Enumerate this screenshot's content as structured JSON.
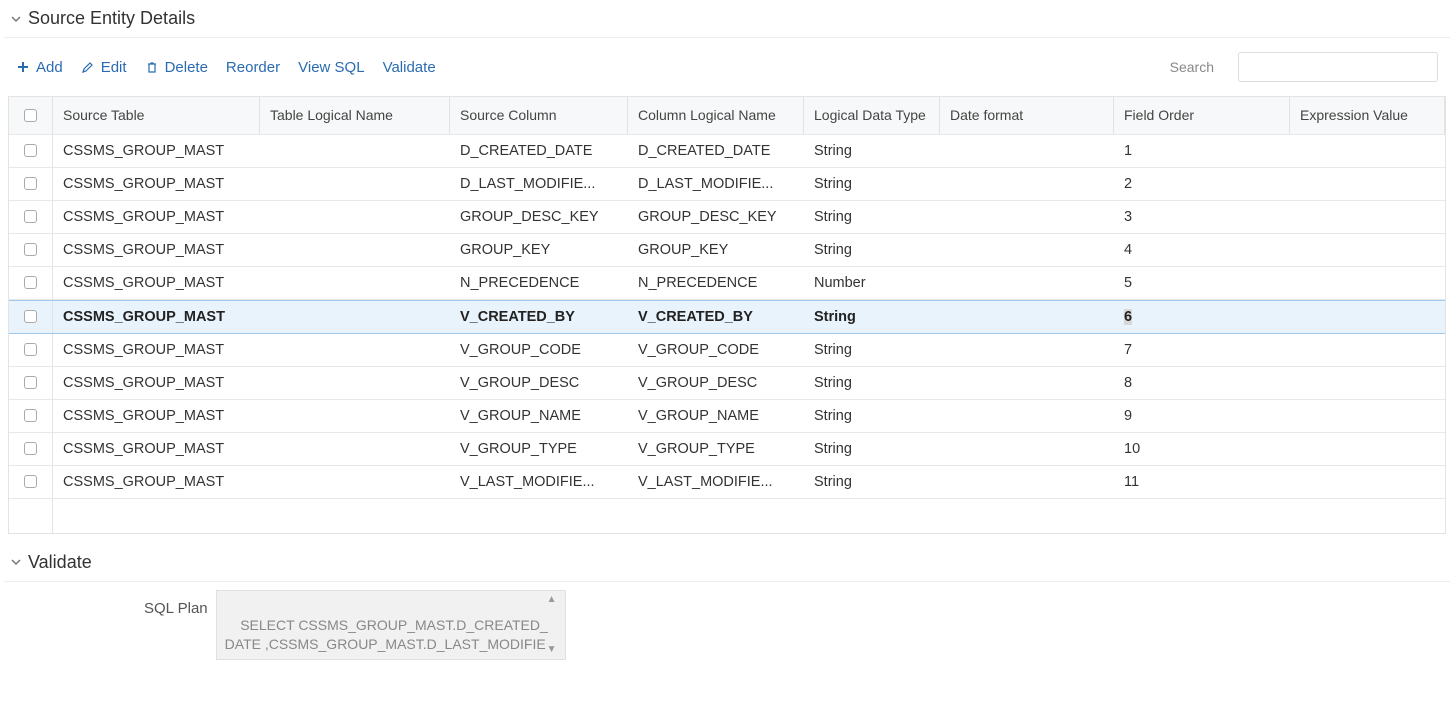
{
  "section": {
    "title": "Source Entity Details"
  },
  "toolbar": {
    "add": "Add",
    "edit": "Edit",
    "delete": "Delete",
    "reorder": "Reorder",
    "viewsql": "View SQL",
    "validate": "Validate",
    "search_label": "Search",
    "search_value": ""
  },
  "columns": [
    "Source Table",
    "Table Logical Name",
    "Source Column",
    "Column Logical Name",
    "Logical Data Type",
    "Date format",
    "Field Order",
    "Expression Value"
  ],
  "rows": [
    {
      "selected": false,
      "cells": [
        "CSSMS_GROUP_MAST",
        "",
        "D_CREATED_DATE",
        "D_CREATED_DATE",
        "String",
        "",
        "1",
        ""
      ]
    },
    {
      "selected": false,
      "cells": [
        "CSSMS_GROUP_MAST",
        "",
        "D_LAST_MODIFIE...",
        "D_LAST_MODIFIE...",
        "String",
        "",
        "2",
        ""
      ]
    },
    {
      "selected": false,
      "cells": [
        "CSSMS_GROUP_MAST",
        "",
        "GROUP_DESC_KEY",
        "GROUP_DESC_KEY",
        "String",
        "",
        "3",
        ""
      ]
    },
    {
      "selected": false,
      "cells": [
        "CSSMS_GROUP_MAST",
        "",
        "GROUP_KEY",
        "GROUP_KEY",
        "String",
        "",
        "4",
        ""
      ]
    },
    {
      "selected": false,
      "cells": [
        "CSSMS_GROUP_MAST",
        "",
        "N_PRECEDENCE",
        "N_PRECEDENCE",
        "Number",
        "",
        "5",
        ""
      ]
    },
    {
      "selected": true,
      "cells": [
        "CSSMS_GROUP_MAST",
        "",
        "V_CREATED_BY",
        "V_CREATED_BY",
        "String",
        "",
        "6",
        ""
      ]
    },
    {
      "selected": false,
      "cells": [
        "CSSMS_GROUP_MAST",
        "",
        "V_GROUP_CODE",
        "V_GROUP_CODE",
        "String",
        "",
        "7",
        ""
      ]
    },
    {
      "selected": false,
      "cells": [
        "CSSMS_GROUP_MAST",
        "",
        "V_GROUP_DESC",
        "V_GROUP_DESC",
        "String",
        "",
        "8",
        ""
      ]
    },
    {
      "selected": false,
      "cells": [
        "CSSMS_GROUP_MAST",
        "",
        "V_GROUP_NAME",
        "V_GROUP_NAME",
        "String",
        "",
        "9",
        ""
      ]
    },
    {
      "selected": false,
      "cells": [
        "CSSMS_GROUP_MAST",
        "",
        "V_GROUP_TYPE",
        "V_GROUP_TYPE",
        "String",
        "",
        "10",
        ""
      ]
    },
    {
      "selected": false,
      "cells": [
        "CSSMS_GROUP_MAST",
        "",
        "V_LAST_MODIFIE...",
        "V_LAST_MODIFIE...",
        "String",
        "",
        "11",
        ""
      ]
    }
  ],
  "validate_section": {
    "title": "Validate",
    "label": "SQL Plan",
    "sql": "SELECT CSSMS_GROUP_MAST.D_CREATED_DATE ,CSSMS_GROUP_MAST.D_LAST_MODIFIE"
  }
}
